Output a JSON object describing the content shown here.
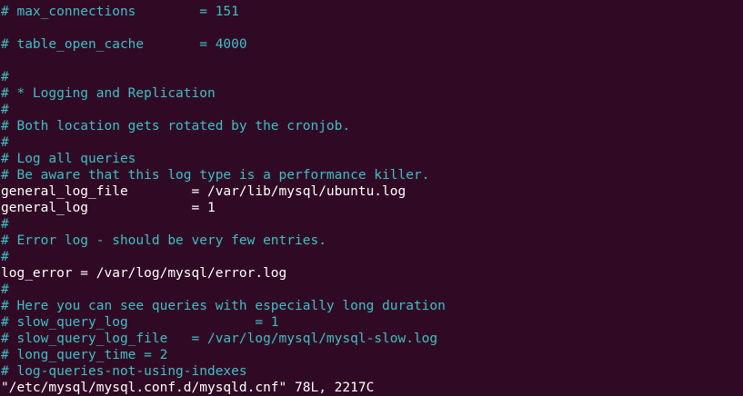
{
  "editor": {
    "lines": [
      {
        "text": "# max_connections        = 151",
        "kind": "comment"
      },
      {
        "text": "",
        "kind": "blank"
      },
      {
        "text": "# table_open_cache       = 4000",
        "kind": "comment"
      },
      {
        "text": "",
        "kind": "blank"
      },
      {
        "text": "#",
        "kind": "comment"
      },
      {
        "text": "# * Logging and Replication",
        "kind": "comment"
      },
      {
        "text": "#",
        "kind": "comment"
      },
      {
        "text": "# Both location gets rotated by the cronjob.",
        "kind": "comment"
      },
      {
        "text": "#",
        "kind": "comment"
      },
      {
        "text": "# Log all queries",
        "kind": "comment"
      },
      {
        "text": "# Be aware that this log type is a performance killer.",
        "kind": "comment"
      },
      {
        "text": "general_log_file        = /var/lib/mysql/ubuntu.log",
        "kind": "setting"
      },
      {
        "text": "general_log             = 1",
        "kind": "setting"
      },
      {
        "text": "#",
        "kind": "comment"
      },
      {
        "text": "# Error log - should be very few entries.",
        "kind": "comment"
      },
      {
        "text": "#",
        "kind": "comment"
      },
      {
        "text": "log_error = /var/log/mysql/error.log",
        "kind": "setting"
      },
      {
        "text": "#",
        "kind": "comment"
      },
      {
        "text": "# Here you can see queries with especially long duration",
        "kind": "comment"
      },
      {
        "text": "# slow_query_log                = 1",
        "kind": "comment"
      },
      {
        "text": "# slow_query_log_file   = /var/log/mysql/mysql-slow.log",
        "kind": "comment"
      },
      {
        "text": "# long_query_time = 2",
        "kind": "comment"
      },
      {
        "text": "# log-queries-not-using-indexes",
        "kind": "comment"
      }
    ],
    "status_line": "\"/etc/mysql/mysql.conf.d/mysqld.cnf\" 78L, 2217C"
  },
  "colors": {
    "background": "#300a24",
    "comment": "#3fbfc7",
    "text": "#ffffff"
  }
}
